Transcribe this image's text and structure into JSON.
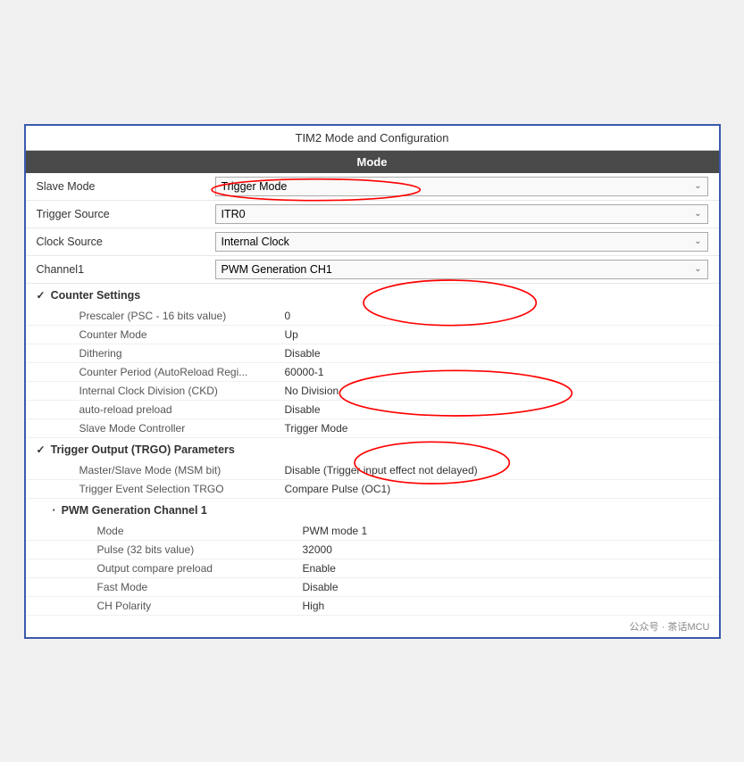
{
  "title": "TIM2 Mode and Configuration",
  "mode_section": "Mode",
  "dropdowns": [
    {
      "label": "Slave Mode",
      "value": "Trigger Mode"
    },
    {
      "label": "Trigger Source",
      "value": "ITR0"
    },
    {
      "label": "Clock Source",
      "value": "Internal Clock"
    },
    {
      "label": "Channel1",
      "value": "PWM Generation CH1"
    }
  ],
  "counter_settings": {
    "header": "Counter Settings",
    "rows": [
      {
        "label": "Prescaler (PSC - 16 bits value)",
        "value": "0"
      },
      {
        "label": "Counter Mode",
        "value": "Up"
      },
      {
        "label": "Dithering",
        "value": "Disable"
      },
      {
        "label": "Counter Period (AutoReload Regi...",
        "value": "60000-1"
      },
      {
        "label": "Internal Clock Division (CKD)",
        "value": "No Division"
      },
      {
        "label": "auto-reload preload",
        "value": "Disable"
      },
      {
        "label": "Slave Mode Controller",
        "value": "Trigger Mode"
      }
    ]
  },
  "trigger_output": {
    "header": "Trigger Output (TRGO) Parameters",
    "rows": [
      {
        "label": "Master/Slave Mode (MSM bit)",
        "value": "Disable (Trigger input effect not delayed)"
      },
      {
        "label": "Trigger Event Selection TRGO",
        "value": "Compare Pulse (OC1)"
      }
    ]
  },
  "pwm_channel": {
    "header": "PWM Generation Channel 1",
    "rows": [
      {
        "label": "Mode",
        "value": "PWM mode 1"
      },
      {
        "label": "Pulse (32 bits value)",
        "value": "32000"
      },
      {
        "label": "Output compare preload",
        "value": "Enable"
      },
      {
        "label": "Fast Mode",
        "value": "Disable"
      },
      {
        "label": "CH Polarity",
        "value": "High"
      }
    ]
  },
  "watermark": "公众号 · 茶话MCU"
}
